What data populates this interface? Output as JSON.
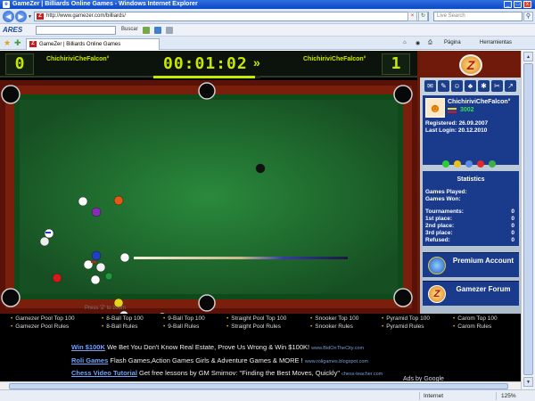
{
  "window": {
    "title": "GameZer | Billiards Online Games - Windows Internet Explorer",
    "app_icon": "ie-icon"
  },
  "addressbar": {
    "url": "http://www.gamezer.com/billiards/",
    "search_placeholder": "Live Search"
  },
  "toolbar": {
    "ares_label": "ARES",
    "ares_search_label": "Buscar"
  },
  "tabs": [
    {
      "label": "GameZer | Billiards Online Games"
    }
  ],
  "commandbar": {
    "page_label": "Página",
    "tools_label": "Herramientas"
  },
  "game": {
    "left_score": "0",
    "right_score": "1",
    "left_player": "ChichiriviCheFalcon°",
    "right_player": "ChichiriviCheFalcon°",
    "timer": "00:01:02",
    "turn_arrow": "»",
    "shot_power": 0.95,
    "zoom_hint": "Press 'Z' to zoom",
    "table_colors": {
      "felt": "#1e6e2c",
      "rail": "#5a1208",
      "wood": "#7a1f0c"
    }
  },
  "side_panel": {
    "logo_letter": "Z",
    "username": "ChichiriviCheFalcon°",
    "points": "3002",
    "registered": "Registered: 26.09.2007",
    "last_login": "Last Login: 20.12.2010",
    "stats_title": "Statistics",
    "stats_rows_1": [
      {
        "label": "Games Played:",
        "value": ""
      },
      {
        "label": "Games Won:",
        "value": ""
      }
    ],
    "stats_rows_2": [
      {
        "label": "Tournaments:",
        "value": "0"
      },
      {
        "label": "1st place:",
        "value": "0"
      },
      {
        "label": "2nd place:",
        "value": "0"
      },
      {
        "label": "3rd place:",
        "value": "0"
      },
      {
        "label": "Refused:",
        "value": "0"
      }
    ],
    "premium_label": "Premium Account",
    "forum_label": "Gamezer Forum"
  },
  "links": [
    "Gamezer Pool Top 100",
    "8-Ball Top 100",
    "9-Ball Top 100",
    "Straight Pool Top 100",
    "Snooker Top 100",
    "Pyramid Top 100",
    "Carom Top 100",
    "Gamezer Pool Rules",
    "8-Ball Rules",
    "9-Ball Rules",
    "Straight Pool Rules",
    "Snooker Rules",
    "Pyramid Rules",
    "Carom Rules"
  ],
  "ads": [
    {
      "head": "Win $100K",
      "text": "We Bet You Don't Know Real Estate, Prove Us Wrong & Win $100K!",
      "src": "www.BidOnTheCity.com"
    },
    {
      "head": "Roli Games",
      "text": "Flash Games,Action Games Girls & Adventure Games & MORE !",
      "src": "www.roligames.blogspot.com"
    },
    {
      "head": "Chess Video Tutorial",
      "text": "Get free lessons by GM Smirnov: \"Finding the Best Moves, Quickly\"",
      "src": "chess-teacher.com"
    }
  ],
  "ad_choice": "Ads by Google",
  "status": {
    "zone": "Internet",
    "zoom": "125%"
  }
}
